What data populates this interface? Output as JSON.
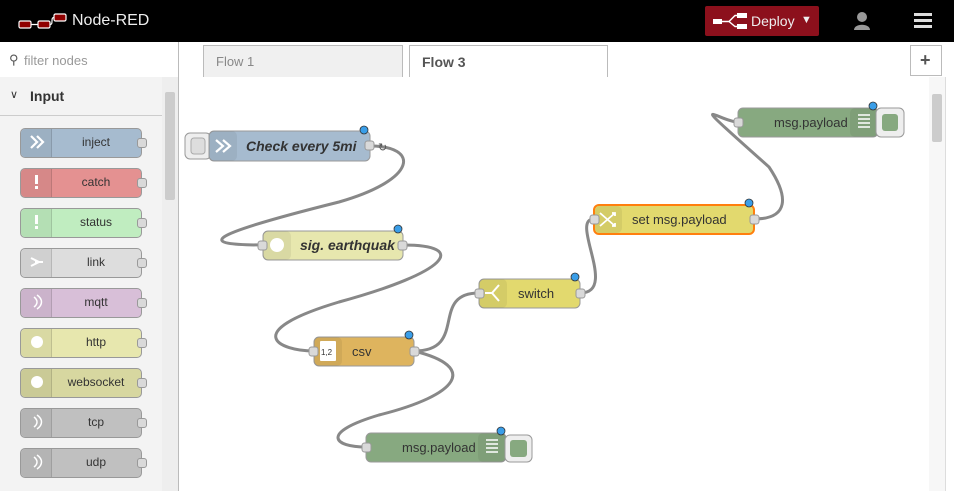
{
  "header": {
    "title": "Node-RED",
    "deploy_label": "Deploy"
  },
  "palette": {
    "filter_placeholder": "filter nodes",
    "category": "Input",
    "nodes": [
      {
        "label": "inject",
        "color": "#a6bbcf"
      },
      {
        "label": "catch",
        "color": "#e49191"
      },
      {
        "label": "status",
        "color": "#c0edc0"
      },
      {
        "label": "link",
        "color": "#dddddd"
      },
      {
        "label": "mqtt",
        "color": "#d8bfd8"
      },
      {
        "label": "http",
        "color": "#e7e7ae"
      },
      {
        "label": "websocket",
        "color": "#d7d7a0"
      },
      {
        "label": "tcp",
        "color": "#c0c0c0"
      },
      {
        "label": "udp",
        "color": "#c0c0c0"
      }
    ]
  },
  "tabs": [
    {
      "label": "Flow 1",
      "active": false
    },
    {
      "label": "Flow 3",
      "active": true
    }
  ],
  "add_tab_label": "+",
  "flow": {
    "nodes": [
      {
        "id": "inject",
        "label": "Check every 5mi",
        "color": "#a6bbcf",
        "italic": true
      },
      {
        "id": "http",
        "label": "sig. earthquak",
        "color": "#e7e7ae",
        "italic": true
      },
      {
        "id": "csv",
        "label": "csv",
        "color": "#deb45e",
        "icon_text": "1,2"
      },
      {
        "id": "switch",
        "label": "switch",
        "color": "#e2d96e"
      },
      {
        "id": "change",
        "label": "set msg.payload",
        "color": "#e2d96e"
      },
      {
        "id": "debug1",
        "label": "msg.payload",
        "color": "#87a980"
      },
      {
        "id": "debug2",
        "label": "msg.payload",
        "color": "#87a980"
      }
    ],
    "inject_repeat_symbol": "↻"
  }
}
